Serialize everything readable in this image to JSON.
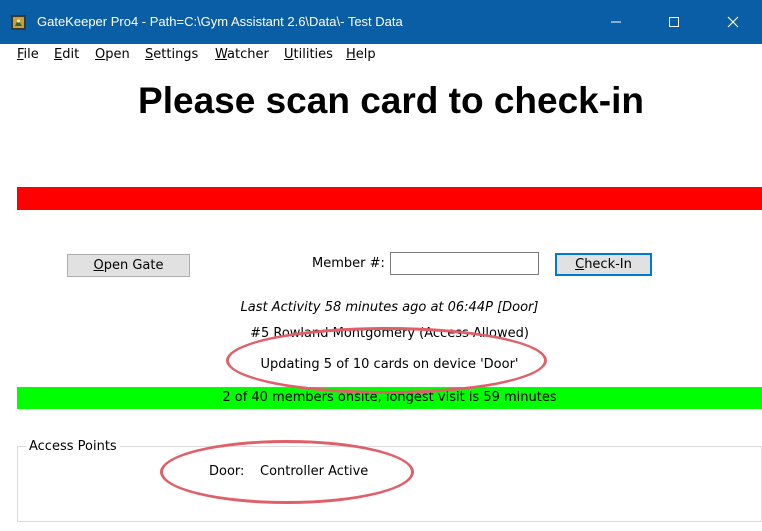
{
  "window": {
    "title": "GateKeeper Pro4 - Path=C:\\Gym Assistant 2.6\\Data\\- Test Data",
    "icon": "gatekeeper-app-icon",
    "controls": [
      "minimize-icon",
      "maximize-icon",
      "close-icon"
    ]
  },
  "menu": {
    "file": {
      "hot": "F",
      "rest": "ile"
    },
    "edit": {
      "hot": "E",
      "rest": "dit"
    },
    "open": {
      "hot": "O",
      "rest": "pen"
    },
    "settings": {
      "hot": "S",
      "rest": "ettings"
    },
    "watcher": {
      "hot": "W",
      "rest": "atcher"
    },
    "utilities": {
      "hot": "U",
      "rest": "tilities"
    },
    "help": {
      "hot": "H",
      "rest": "elp"
    }
  },
  "main": {
    "headline": "Please scan card to check-in",
    "open_gate": {
      "hot": "O",
      "rest": "pen Gate"
    },
    "member_label": "Member #:",
    "member_value": "",
    "check_in": {
      "hot": "C",
      "rest": "heck-In"
    },
    "last_activity": "Last Activity 58 minutes ago at 06:44P [Door]",
    "last_member": "#5 Rowland Montgomery (Access Allowed)",
    "update_status": "Updating 5 of 10 cards on device 'Door'",
    "onsite_status": "2 of 40 members onsite, longest visit is 59 minutes"
  },
  "access_points": {
    "label": "Access Points",
    "door_name": "Door:",
    "door_status": "Controller Active"
  },
  "colors": {
    "titlebar": "#0a5ea6",
    "alert_bar": "#ff0000",
    "status_bar": "#00ff00",
    "annotation": "#e0606a"
  }
}
